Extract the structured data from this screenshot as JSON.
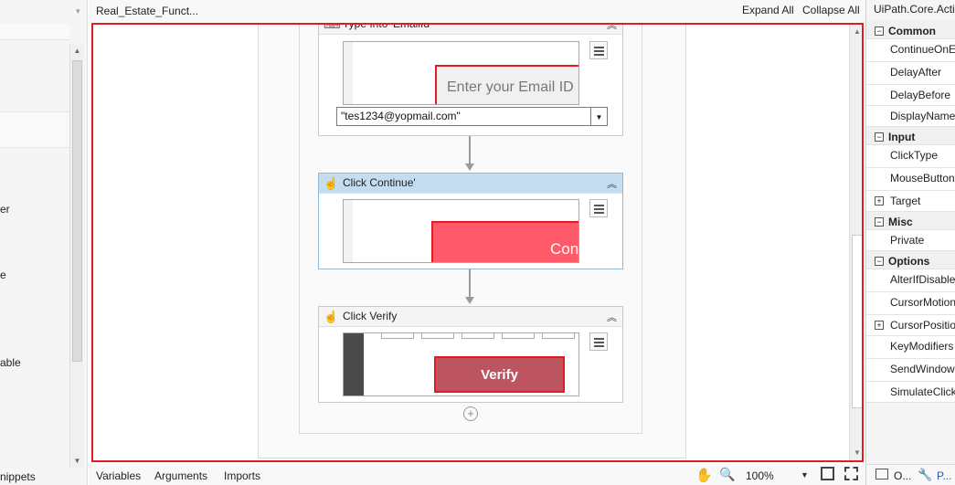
{
  "left_panel": {
    "header_text": "",
    "fragments": [
      "er",
      "e",
      "able"
    ],
    "bottom_tab": "nippets"
  },
  "topbar": {
    "doc_title": "Real_Estate_Funct...",
    "expand_all": "Expand All",
    "collapse_all": "Collapse All"
  },
  "activities": [
    {
      "title": "Type Into 'EmailId'",
      "thumbnail_text": "Enter your Email ID",
      "input_value": "\"tes1234@yopmail.com\""
    },
    {
      "title": "Click Continue'",
      "thumbnail_text": "Con",
      "selected": true
    },
    {
      "title": "Click Verify",
      "thumbnail_text": "Verify"
    }
  ],
  "bottombar": {
    "tabs": [
      "Variables",
      "Arguments",
      "Imports"
    ],
    "zoom": "100%"
  },
  "properties": {
    "title": "UiPath.Core.Activ",
    "rows": [
      {
        "type": "cat",
        "label": "Common"
      },
      {
        "type": "prop",
        "label": "ContinueOnEr"
      },
      {
        "type": "prop",
        "label": "DelayAfter"
      },
      {
        "type": "prop",
        "label": "DelayBefore"
      },
      {
        "type": "prop",
        "label": "DisplayName"
      },
      {
        "type": "cat",
        "label": "Input"
      },
      {
        "type": "prop",
        "label": "ClickType"
      },
      {
        "type": "prop",
        "label": "MouseButton"
      },
      {
        "type": "expand",
        "label": "Target"
      },
      {
        "type": "cat",
        "label": "Misc"
      },
      {
        "type": "prop",
        "label": "Private"
      },
      {
        "type": "cat",
        "label": "Options"
      },
      {
        "type": "prop",
        "label": "AlterIfDisable"
      },
      {
        "type": "prop",
        "label": "CursorMotion"
      },
      {
        "type": "expand",
        "label": "CursorPosition"
      },
      {
        "type": "prop",
        "label": "KeyModifiers"
      },
      {
        "type": "prop",
        "label": "SendWindow"
      },
      {
        "type": "prop",
        "label": "SimulateClick"
      }
    ],
    "bottom_tabs": [
      "O...",
      "P..."
    ]
  },
  "colors": {
    "highlight_border": "#e31b23",
    "selected_header": "#c5ddf0",
    "continue_button": "#ff5a6a",
    "verify_button": "#bd5560"
  }
}
